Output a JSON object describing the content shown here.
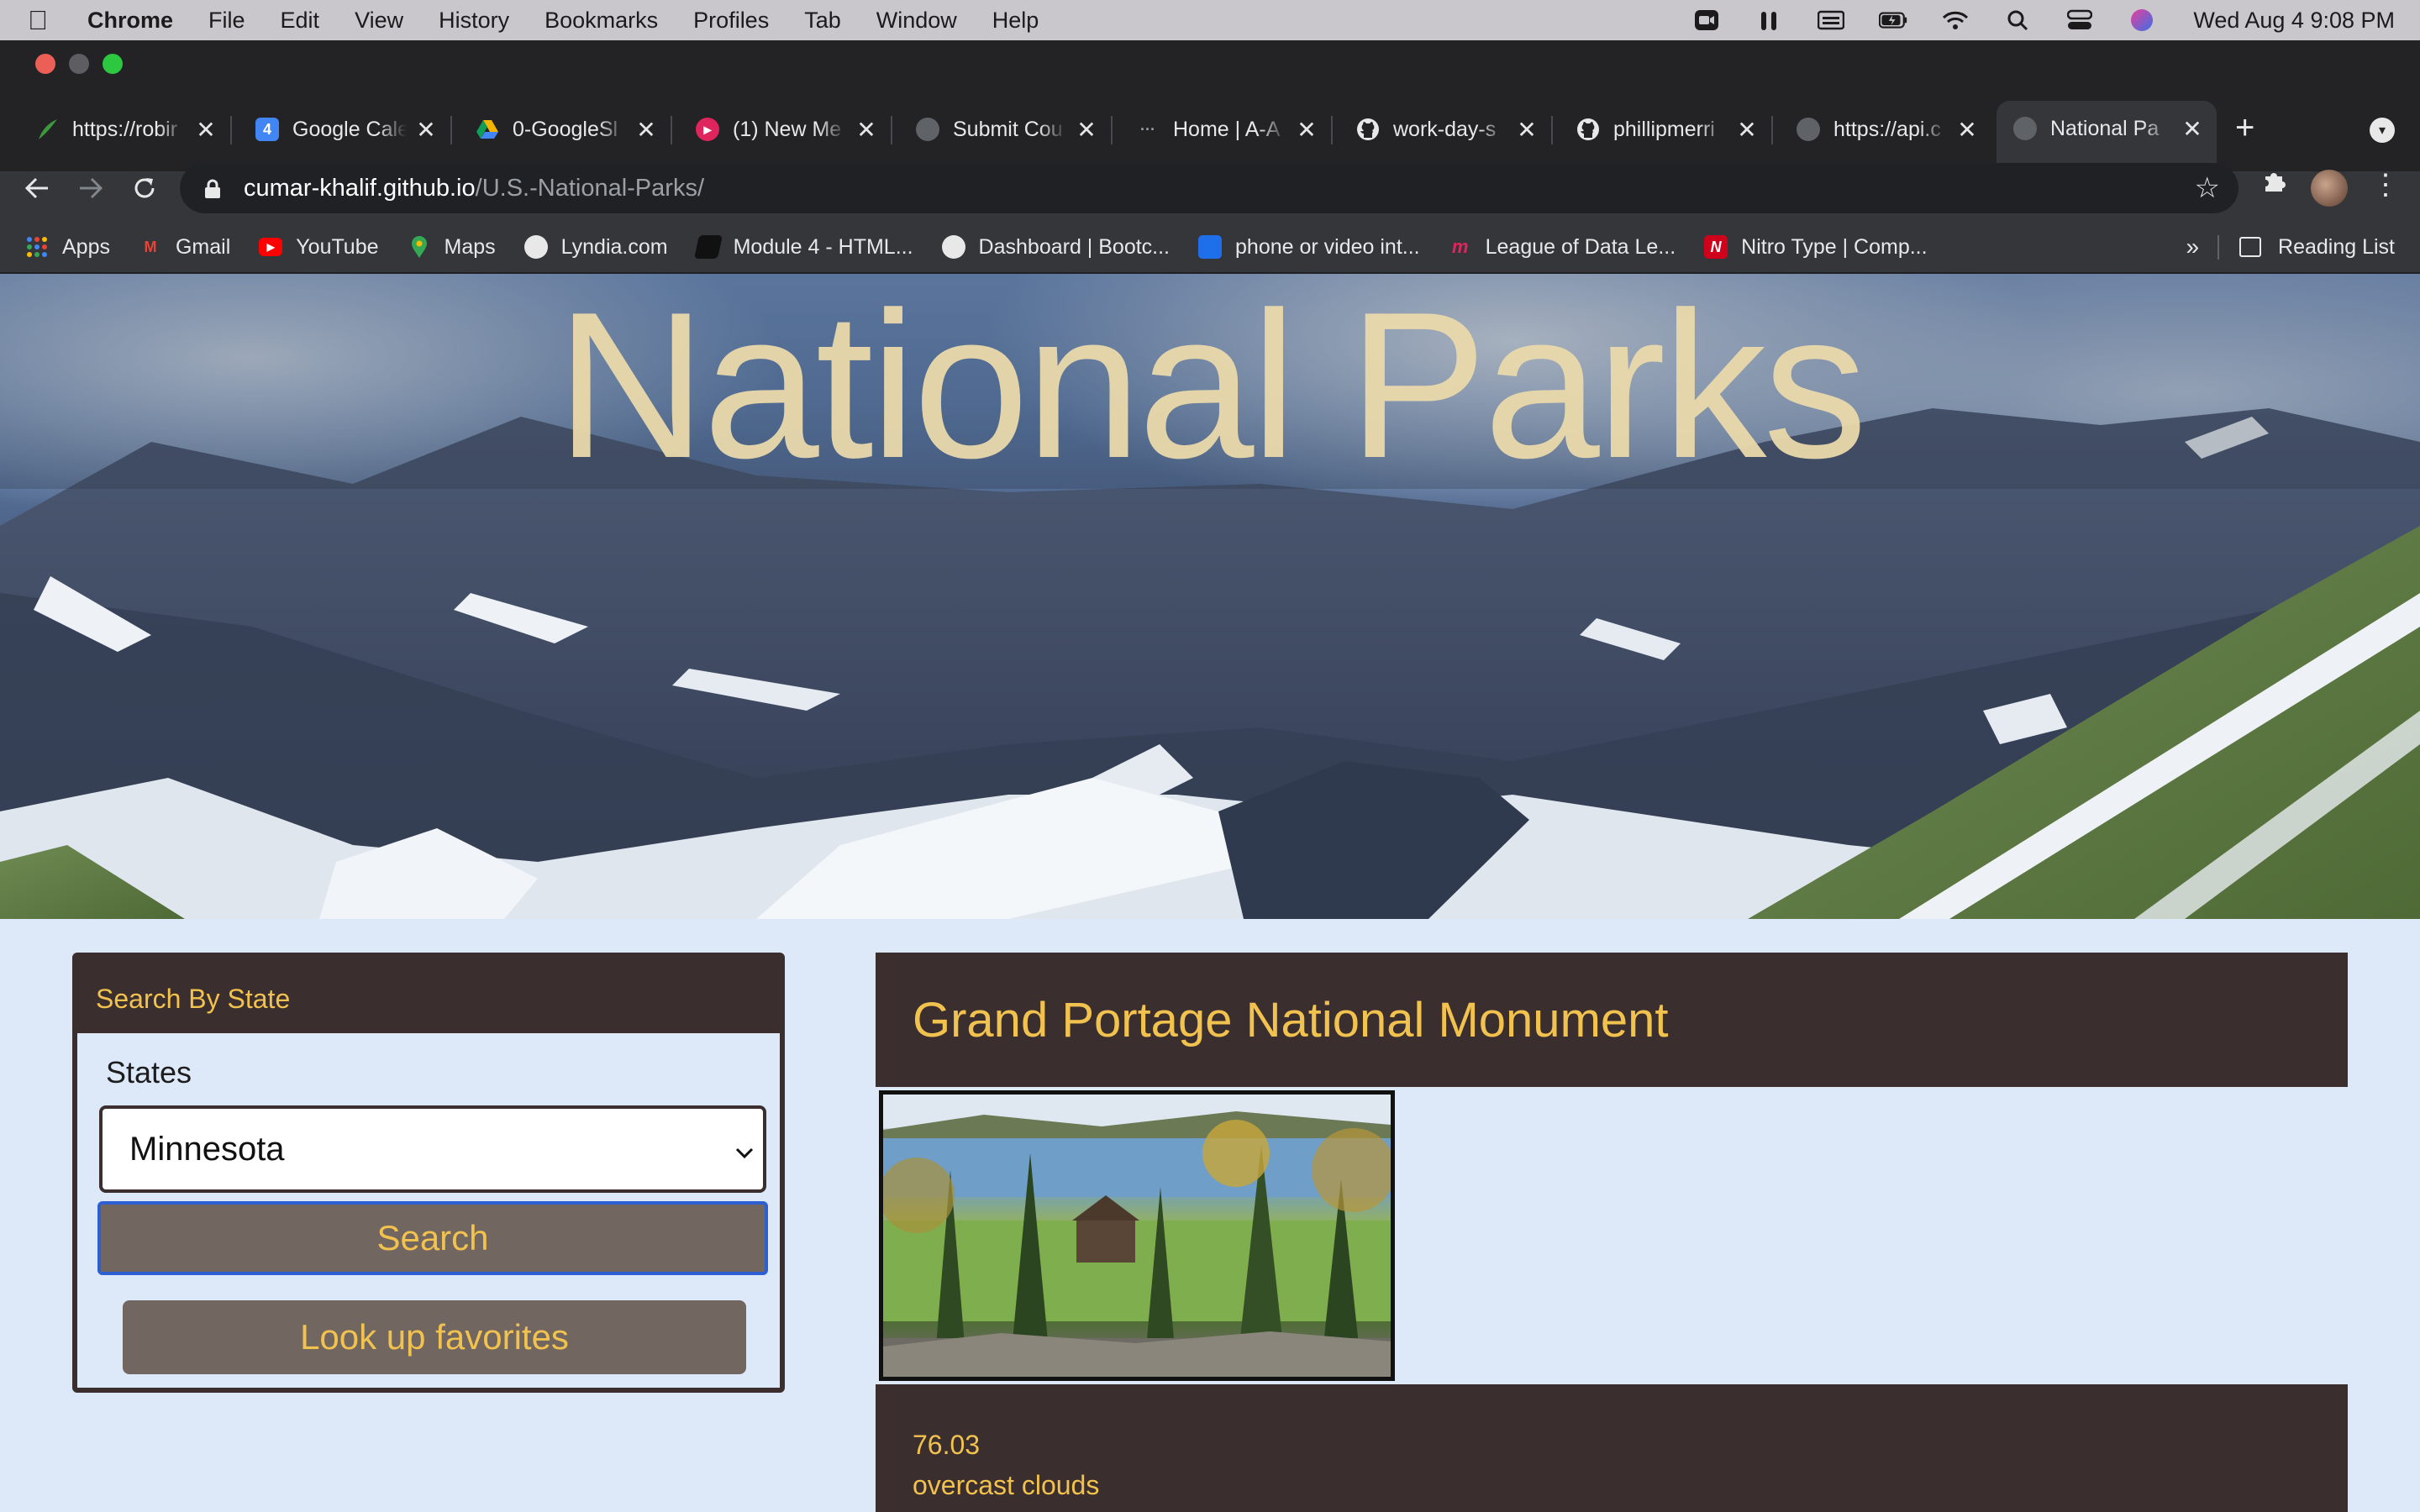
{
  "menubar": {
    "app_name": "Chrome",
    "items": [
      "File",
      "Edit",
      "View",
      "History",
      "Bookmarks",
      "Profiles",
      "Tab",
      "Window",
      "Help"
    ],
    "clock": "Wed Aug 4  9:08 PM"
  },
  "tabs": [
    {
      "title": "https://robir",
      "favicon_color": "#3c9a3c"
    },
    {
      "title": "Google Cale",
      "favicon_color": "#4285f4",
      "favicon_text": "4"
    },
    {
      "title": "0-GoogleSl",
      "favicon_color": "#f4b400"
    },
    {
      "title": "(1) New Me",
      "favicon_color": "#e0245e"
    },
    {
      "title": "Submit Cou",
      "favicon_color": "#5f6368"
    },
    {
      "title": "Home | A-A",
      "favicon_color": "#232326"
    },
    {
      "title": "work-day-s",
      "favicon_color": "#e8e8e8"
    },
    {
      "title": "phillipmerri",
      "favicon_color": "#e8e8e8"
    },
    {
      "title": "https://api.c",
      "favicon_color": "#5f6368"
    },
    {
      "title": "National Pa",
      "favicon_color": "#5f6368",
      "active": true
    }
  ],
  "address": {
    "host": "cumar-khalif.github.io",
    "path": "/U.S.-National-Parks/"
  },
  "bookmarks": [
    {
      "label": "Apps",
      "icon_color": "#4285f4"
    },
    {
      "label": "Gmail",
      "icon_color": "#ea4335",
      "icon_text": "M"
    },
    {
      "label": "YouTube",
      "icon_color": "#ff0000"
    },
    {
      "label": "Maps",
      "icon_color": "#34a853"
    },
    {
      "label": "Lyndia.com",
      "icon_color": "#e8e8e8"
    },
    {
      "label": "Module 4 - HTML...",
      "icon_color": "#202124"
    },
    {
      "label": "Dashboard | Bootc...",
      "icon_color": "#e8e8e8"
    },
    {
      "label": "phone or video int...",
      "icon_color": "#1f6feb"
    },
    {
      "label": "League of Data Le...",
      "icon_color": "#e0245e"
    },
    {
      "label": "Nitro Type | Comp...",
      "icon_color": "#d0021b",
      "icon_text": "N"
    }
  ],
  "bookmarks_overflow": "»",
  "reading_list": "Reading List",
  "hero": {
    "title": "National Parks"
  },
  "sidebar": {
    "heading": "Search By State",
    "states_label": "States",
    "selected_state": "Minnesota",
    "search_label": "Search",
    "favorites_label": "Look up favorites"
  },
  "park": {
    "name": "Grand Portage National Monument",
    "temperature": "76.03",
    "conditions": "overcast clouds"
  },
  "colors": {
    "accent_text": "#f2c24e",
    "panel_bg": "#3b2e2e",
    "button_bg": "#726660",
    "page_bg": "#dde8f9",
    "focus_border": "#2d5fd3"
  }
}
